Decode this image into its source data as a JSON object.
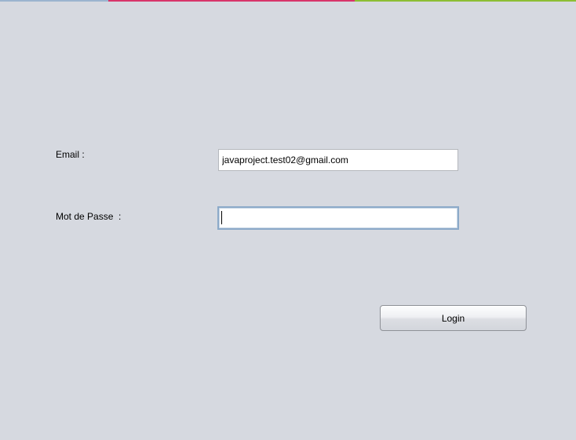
{
  "form": {
    "email_label": "Email :",
    "email_value": "javaproject.test02@gmail.com",
    "password_label": "Mot de Passe  :",
    "password_value": "",
    "login_label": "Login"
  },
  "colors": {
    "background": "#d6d9e0",
    "strip": [
      "#9bb4cf",
      "#d8356a",
      "#8dbe34"
    ],
    "focus_border": "#8caac9"
  }
}
